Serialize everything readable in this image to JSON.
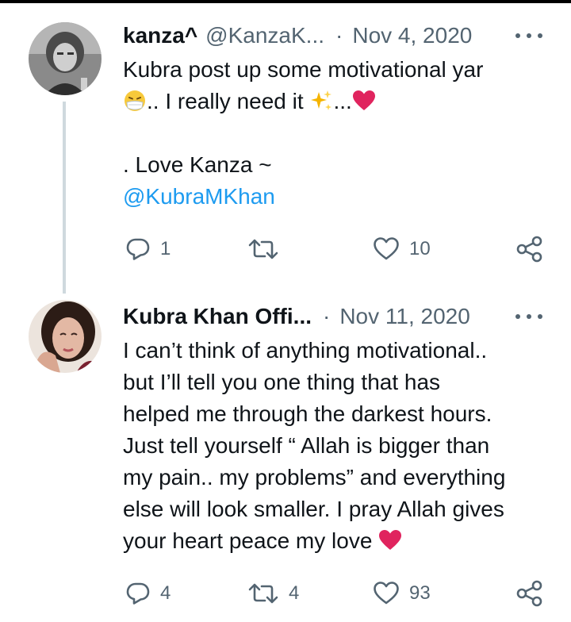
{
  "tweets": [
    {
      "author": {
        "name": "kanza^",
        "handle": "@KanzaK...",
        "date": "Nov 4, 2020"
      },
      "lines": [
        "Kubra post up some motivational yar",
        ".. I really need it ",
        "...",
        "",
        ". Love Kanza ~",
        "@KubraMKhan"
      ],
      "emojis": [
        "face-with-medical-mask-emoji",
        "sparkles-emoji",
        "red-heart-emoji"
      ],
      "actions": {
        "replies": "1",
        "retweets": "",
        "likes": "10"
      }
    },
    {
      "author": {
        "name": "Kubra Khan Offi...",
        "date": "Nov 11, 2020"
      },
      "lines": [
        "I can’t think of anything motivational..",
        "but I’ll tell you one thing that has",
        "helped me through the darkest hours.",
        "Just tell yourself “ Allah is bigger than",
        "my pain.. my problems” and everything",
        "else will look smaller. I pray Allah gives",
        "your heart peace my love "
      ],
      "emojis": [
        "red-heart-emoji"
      ],
      "actions": {
        "replies": "4",
        "retweets": "4",
        "likes": "93"
      }
    }
  ],
  "colors": {
    "text": "#0f1419",
    "secondary": "#536471",
    "mention": "#1d9bf0",
    "thread_line": "#cfd9de",
    "heart": "#e0245e"
  }
}
